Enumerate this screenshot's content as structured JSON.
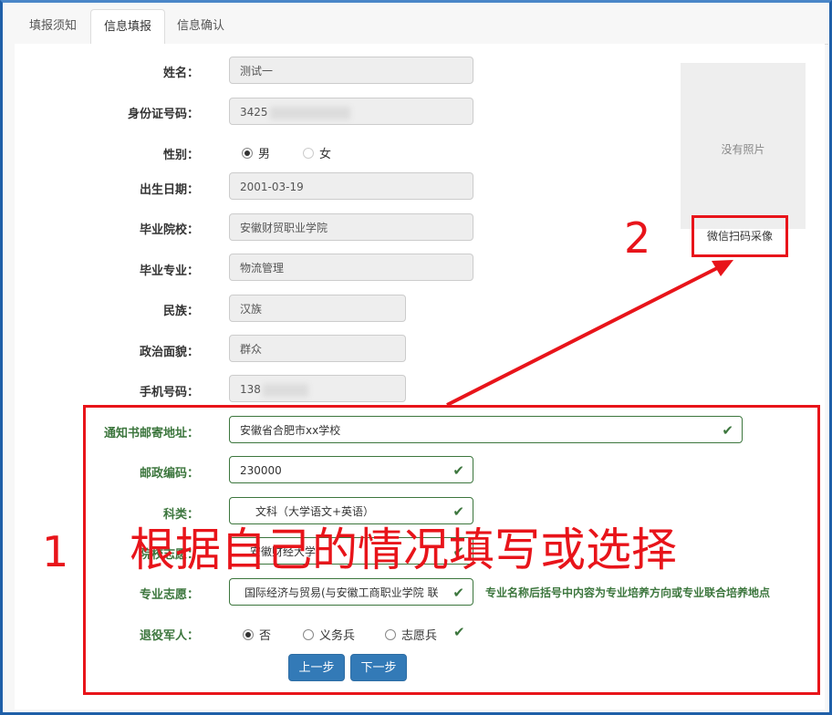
{
  "tabs": [
    "填报须知",
    "信息填报",
    "信息确认"
  ],
  "form": {
    "name_label": "姓名：",
    "name_value": "测试一",
    "id_label": "身份证号码：",
    "id_prefix": "3425",
    "gender_label": "性别：",
    "gender_male": "男",
    "gender_female": "女",
    "birth_label": "出生日期：",
    "birth_value": "2001-03-19",
    "school_label": "毕业院校：",
    "school_value": "安徽财贸职业学院",
    "major_label": "毕业专业：",
    "major_value": "物流管理",
    "ethnic_label": "民族：",
    "ethnic_value": "汉族",
    "political_label": "政治面貌：",
    "political_value": "群众",
    "phone_label": "手机号码：",
    "phone_prefix": "138",
    "address_label": "通知书邮寄地址：",
    "address_value": "安徽省合肥市xx学校",
    "postal_label": "邮政编码：",
    "postal_value": "230000",
    "category_label": "科类：",
    "category_value": "文科（大学语文+英语）",
    "college_label": "院校志愿：",
    "college_value": "安徽财经大学",
    "pref_label": "专业志愿：",
    "pref_value": "国际经济与贸易(与安徽工商职业学院 联",
    "pref_hint": "专业名称后括号中内容为专业培养方向或专业联合培养地点",
    "veteran_label": "退役军人：",
    "veteran_no": "否",
    "veteran_compulsory": "义务兵",
    "veteran_volunteer": "志愿兵"
  },
  "photo": {
    "placeholder": "没有照片",
    "wechat_button": "微信扫码采像"
  },
  "buttons": {
    "prev": "上一步",
    "next": "下一步"
  },
  "annotations": {
    "num1": "1",
    "text1": "根据自己的情况填写或选择",
    "num2": "2"
  },
  "icons": {
    "check": "✔"
  },
  "colors": {
    "accent_red": "#e8141a",
    "valid_green": "#3c763d",
    "primary_blue": "#337ab7"
  }
}
